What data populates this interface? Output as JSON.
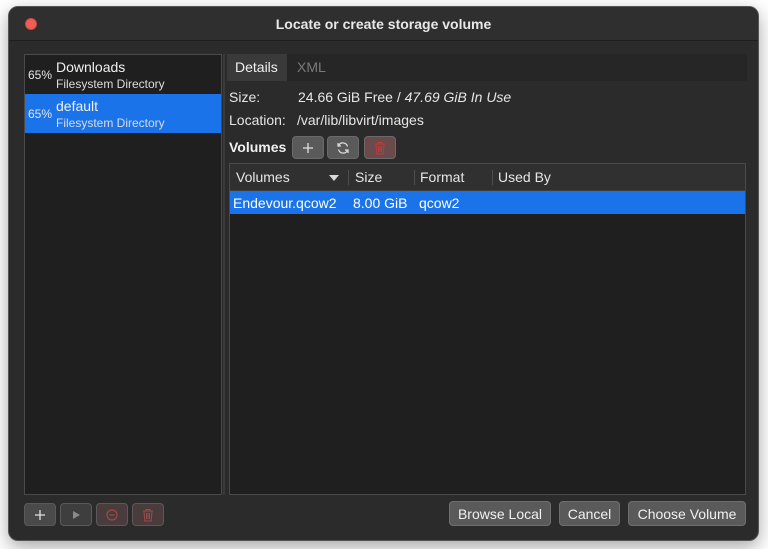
{
  "window": {
    "title": "Locate or create storage volume"
  },
  "pools": [
    {
      "percent": "65%",
      "name": "Downloads",
      "type": "Filesystem Directory",
      "selected": false
    },
    {
      "percent": "65%",
      "name": "default",
      "type": "Filesystem Directory",
      "selected": true
    }
  ],
  "tabs": [
    {
      "label": "Details",
      "active": true
    },
    {
      "label": "XML",
      "active": false
    }
  ],
  "details": {
    "size_label": "Size:",
    "size_free": "24.66 GiB Free /",
    "size_in_use": "47.69 GiB In Use",
    "location_label": "Location:",
    "location_value": "/var/lib/libvirt/images",
    "volumes_label": "Volumes"
  },
  "volume_table": {
    "columns": [
      "Volumes",
      "Size",
      "Format",
      "Used By"
    ],
    "rows": [
      {
        "name": "Endevour.qcow2",
        "size": "8.00 GiB",
        "format": "qcow2",
        "used_by": ""
      }
    ]
  },
  "buttons": {
    "browse_local": "Browse Local",
    "cancel": "Cancel",
    "choose_volume": "Choose Volume"
  },
  "icons": {
    "add": "plus-icon",
    "refresh": "refresh-icon",
    "delete": "trash-icon",
    "start": "play-icon",
    "stop": "stop-icon"
  },
  "colors": {
    "selection": "#1a73e8",
    "close_dot": "#ec5f57",
    "danger": "#c0393b"
  }
}
